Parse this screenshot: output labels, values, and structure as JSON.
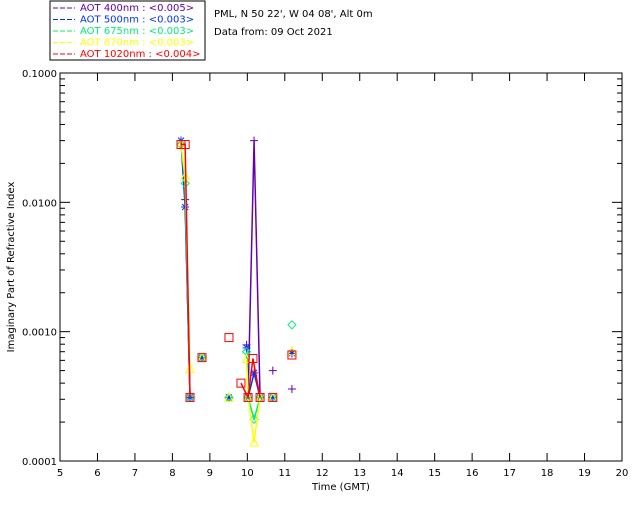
{
  "chart_data": {
    "type": "scatter",
    "title_lines": [
      "PML, N 50 22', W 04 08', Alt 0m",
      "Data from: 09 Oct 2021"
    ],
    "xlabel": "Time (GMT)",
    "ylabel": "Imaginary Part of Refractive Index",
    "xlim": [
      5,
      20
    ],
    "ylim": [
      0.0001,
      0.1
    ],
    "yscale": "log",
    "grid": false,
    "legend_placement": "top-left",
    "xticks": [
      "5",
      "6",
      "7",
      "8",
      "9",
      "10",
      "11",
      "12",
      "13",
      "14",
      "15",
      "16",
      "17",
      "18",
      "19",
      "20"
    ],
    "yticks": [
      {
        "value": 0.1,
        "label": "0.1000"
      },
      {
        "value": 0.01,
        "label": "0.0100"
      },
      {
        "value": 0.001,
        "label": "0.0010"
      },
      {
        "value": 0.0001,
        "label": "0.0001"
      }
    ],
    "series": [
      {
        "name": "AOT  400nm : <0.005>",
        "label": "AOT  400nm",
        "aot": "<0.005>",
        "color": "#6600aa",
        "marker": "plus",
        "runs": [
          [
            [
              8.23,
              0.03
            ],
            [
              8.34,
              0.0105
            ],
            [
              8.47,
              0.00031
            ]
          ],
          [
            [
              8.79,
              0.00063
            ]
          ],
          [
            [
              9.51,
              0.00031
            ]
          ],
          [
            [
              9.98,
              0.00079
            ],
            [
              10.02,
              0.00031
            ],
            [
              10.18,
              0.03
            ],
            [
              10.34,
              0.00031
            ]
          ],
          [
            [
              10.68,
              0.0005
            ]
          ],
          [
            [
              11.19,
              0.00036
            ]
          ],
          [
            [
              11.19,
              0.00068
            ]
          ]
        ]
      },
      {
        "name": "AOT  500nm : <0.003>",
        "label": "AOT  500nm",
        "aot": "<0.003>",
        "color": "#0033ff",
        "marker": "asterisk",
        "runs": [
          [
            [
              8.23,
              0.03
            ],
            [
              8.34,
              0.0092
            ],
            [
              8.47,
              0.00031
            ]
          ],
          [
            [
              8.79,
              0.00063
            ]
          ],
          [
            [
              9.51,
              0.00031
            ]
          ],
          [
            [
              9.98,
              0.00075
            ],
            [
              10.02,
              0.00031
            ],
            [
              10.18,
              0.00048
            ],
            [
              10.34,
              0.00031
            ]
          ],
          [
            [
              10.68,
              0.00031
            ]
          ],
          [
            [
              11.19,
              0.00068
            ]
          ]
        ]
      },
      {
        "name": "AOT  675nm : <0.003>",
        "label": "AOT  675nm",
        "aot": "<0.003>",
        "color": "#00ee77",
        "marker": "diamond",
        "runs": [
          [
            [
              8.23,
              0.028
            ],
            [
              8.34,
              0.014
            ],
            [
              8.47,
              0.00031
            ]
          ],
          [
            [
              8.79,
              0.00063
            ]
          ],
          [
            [
              9.51,
              0.00031
            ]
          ],
          [
            [
              9.98,
              0.0007
            ],
            [
              10.02,
              0.00031
            ],
            [
              10.18,
              0.00021
            ],
            [
              10.34,
              0.00031
            ]
          ],
          [
            [
              10.68,
              0.00031
            ]
          ],
          [
            [
              11.19,
              0.00113
            ]
          ]
        ]
      },
      {
        "name": "AOT  870nm : <0.003>",
        "label": "AOT  870nm",
        "aot": "<0.003>",
        "color": "#ffff00",
        "marker": "triangle",
        "runs": [
          [
            [
              8.23,
              0.028
            ],
            [
              8.34,
              0.016
            ],
            [
              8.47,
              0.00052
            ]
          ],
          [
            [
              8.79,
              0.00063
            ]
          ],
          [
            [
              9.51,
              0.00031
            ]
          ],
          [
            [
              9.98,
              0.00062
            ],
            [
              10.02,
              0.00031
            ],
            [
              10.18,
              0.00014
            ],
            [
              10.34,
              0.00031
            ]
          ],
          [
            [
              10.68,
              0.00031
            ]
          ],
          [
            [
              11.19,
              0.00071
            ]
          ]
        ]
      },
      {
        "name": "AOT 1020nm : <0.004>",
        "label": "AOT 1020nm",
        "aot": "<0.004>",
        "color": "#ff0000",
        "marker": "square",
        "runs": [
          [
            [
              8.23,
              0.028
            ],
            [
              8.34,
              0.028
            ],
            [
              8.47,
              0.00031
            ]
          ],
          [
            [
              8.79,
              0.00063
            ]
          ],
          [
            [
              9.51,
              0.0009
            ]
          ],
          [
            [
              9.83,
              0.0004
            ],
            [
              10.02,
              0.00031
            ],
            [
              10.15,
              0.00062
            ],
            [
              10.34,
              0.00031
            ]
          ],
          [
            [
              10.68,
              0.00031
            ]
          ],
          [
            [
              11.19,
              0.00066
            ]
          ]
        ]
      }
    ]
  }
}
